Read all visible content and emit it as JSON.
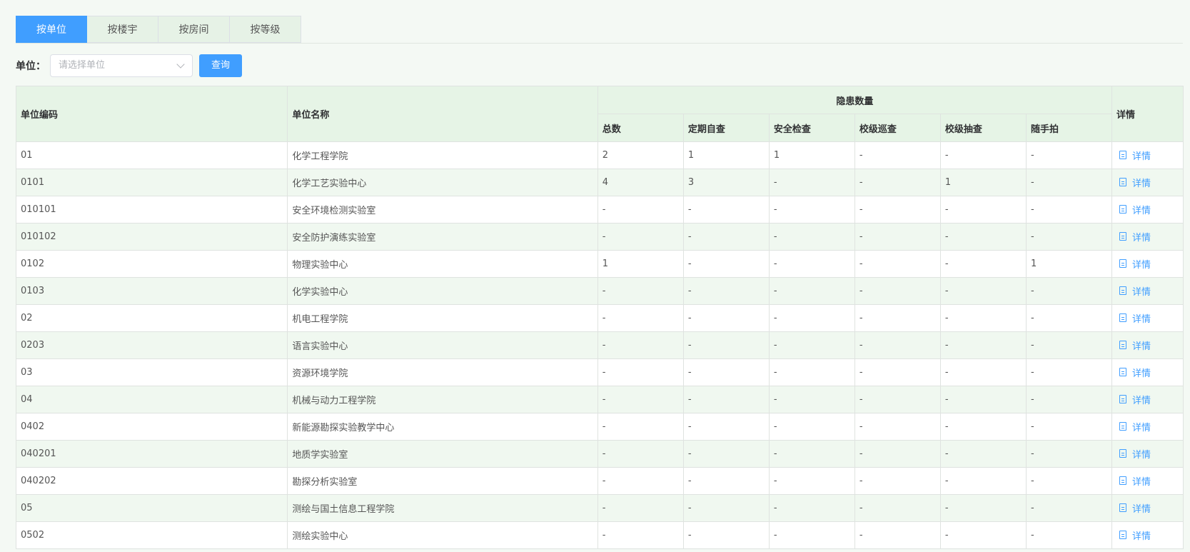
{
  "tabs": [
    {
      "label": "按单位",
      "active": true
    },
    {
      "label": "按楼宇",
      "active": false
    },
    {
      "label": "按房间",
      "active": false
    },
    {
      "label": "按等级",
      "active": false
    }
  ],
  "filter": {
    "label": "单位：",
    "select_placeholder": "请选择单位",
    "query_button": "查询"
  },
  "table": {
    "headers": {
      "code": "单位编码",
      "name": "单位名称",
      "group": "隐患数量",
      "total": "总数",
      "periodic": "定期自查",
      "safety": "安全检查",
      "patrol": "校级巡查",
      "spot": "校级抽查",
      "snapshot": "随手拍",
      "detail": "详情"
    },
    "detail_label": "详情",
    "rows": [
      [
        "01",
        "化学工程学院",
        "2",
        "1",
        "1",
        "-",
        "-",
        "-"
      ],
      [
        "0101",
        "化学工艺实验中心",
        "4",
        "3",
        "-",
        "-",
        "1",
        "-"
      ],
      [
        "010101",
        "安全环境检测实验室",
        "-",
        "-",
        "-",
        "-",
        "-",
        "-"
      ],
      [
        "010102",
        "安全防护演练实验室",
        "-",
        "-",
        "-",
        "-",
        "-",
        "-"
      ],
      [
        "0102",
        "物理实验中心",
        "1",
        "-",
        "-",
        "-",
        "-",
        "1"
      ],
      [
        "0103",
        "化学实验中心",
        "-",
        "-",
        "-",
        "-",
        "-",
        "-"
      ],
      [
        "02",
        "机电工程学院",
        "-",
        "-",
        "-",
        "-",
        "-",
        "-"
      ],
      [
        "0203",
        "语言实验中心",
        "-",
        "-",
        "-",
        "-",
        "-",
        "-"
      ],
      [
        "03",
        "资源环境学院",
        "-",
        "-",
        "-",
        "-",
        "-",
        "-"
      ],
      [
        "04",
        "机械与动力工程学院",
        "-",
        "-",
        "-",
        "-",
        "-",
        "-"
      ],
      [
        "0402",
        "新能源勘探实验教学中心",
        "-",
        "-",
        "-",
        "-",
        "-",
        "-"
      ],
      [
        "040201",
        "地质学实验室",
        "-",
        "-",
        "-",
        "-",
        "-",
        "-"
      ],
      [
        "040202",
        "勘探分析实验室",
        "-",
        "-",
        "-",
        "-",
        "-",
        "-"
      ],
      [
        "05",
        "测绘与国土信息工程学院",
        "-",
        "-",
        "-",
        "-",
        "-",
        "-"
      ],
      [
        "0502",
        "测绘实验中心",
        "-",
        "-",
        "-",
        "-",
        "-",
        "-"
      ]
    ]
  },
  "colors": {
    "primary": "#409eff",
    "header_bg": "#e6f4e6",
    "stripe_bg": "#f0f8f0",
    "page_bg": "#f4f9f4"
  }
}
